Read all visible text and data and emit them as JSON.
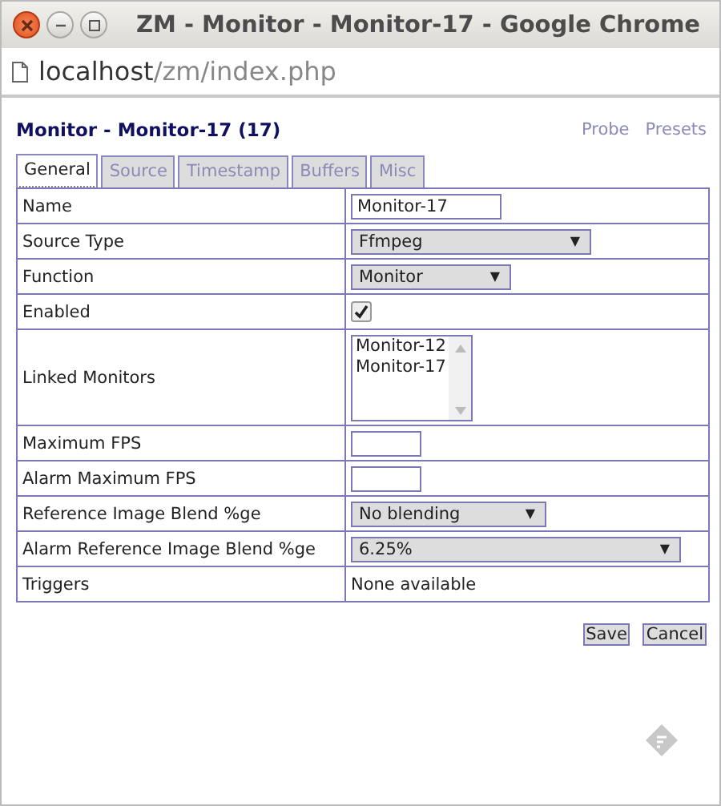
{
  "window": {
    "title": "ZM - Monitor - Monitor-17 - Google Chrome"
  },
  "address_bar": {
    "host": "localhost",
    "path": "/zm/index.php"
  },
  "heading": "Monitor - Monitor-17 (17)",
  "header_links": [
    "Probe",
    "Presets"
  ],
  "tabs": [
    {
      "label": "General",
      "selected": true
    },
    {
      "label": "Source",
      "selected": false
    },
    {
      "label": "Timestamp",
      "selected": false
    },
    {
      "label": "Buffers",
      "selected": false
    },
    {
      "label": "Misc",
      "selected": false
    }
  ],
  "rows": [
    {
      "label": "Name",
      "kind": "text",
      "value": "Monitor-17"
    },
    {
      "label": "Source Type",
      "kind": "select",
      "value": "Ffmpeg"
    },
    {
      "label": "Function",
      "kind": "select",
      "value": "Monitor"
    },
    {
      "label": "Enabled",
      "kind": "checkbox",
      "checked": true
    },
    {
      "label": "Linked Monitors",
      "kind": "listbox",
      "options": [
        "Monitor-12",
        "Monitor-17"
      ]
    },
    {
      "label": "Maximum FPS",
      "kind": "number",
      "value": ""
    },
    {
      "label": "Alarm Maximum FPS",
      "kind": "number",
      "value": ""
    },
    {
      "label": "Reference Image Blend %ge",
      "kind": "select",
      "value": "No blending"
    },
    {
      "label": "Alarm Reference Image Blend %ge",
      "kind": "select",
      "value": "6.25%"
    },
    {
      "label": "Triggers",
      "kind": "static",
      "value": "None available"
    }
  ],
  "buttons": [
    "Save",
    "Cancel"
  ],
  "select_arrow": "▼"
}
